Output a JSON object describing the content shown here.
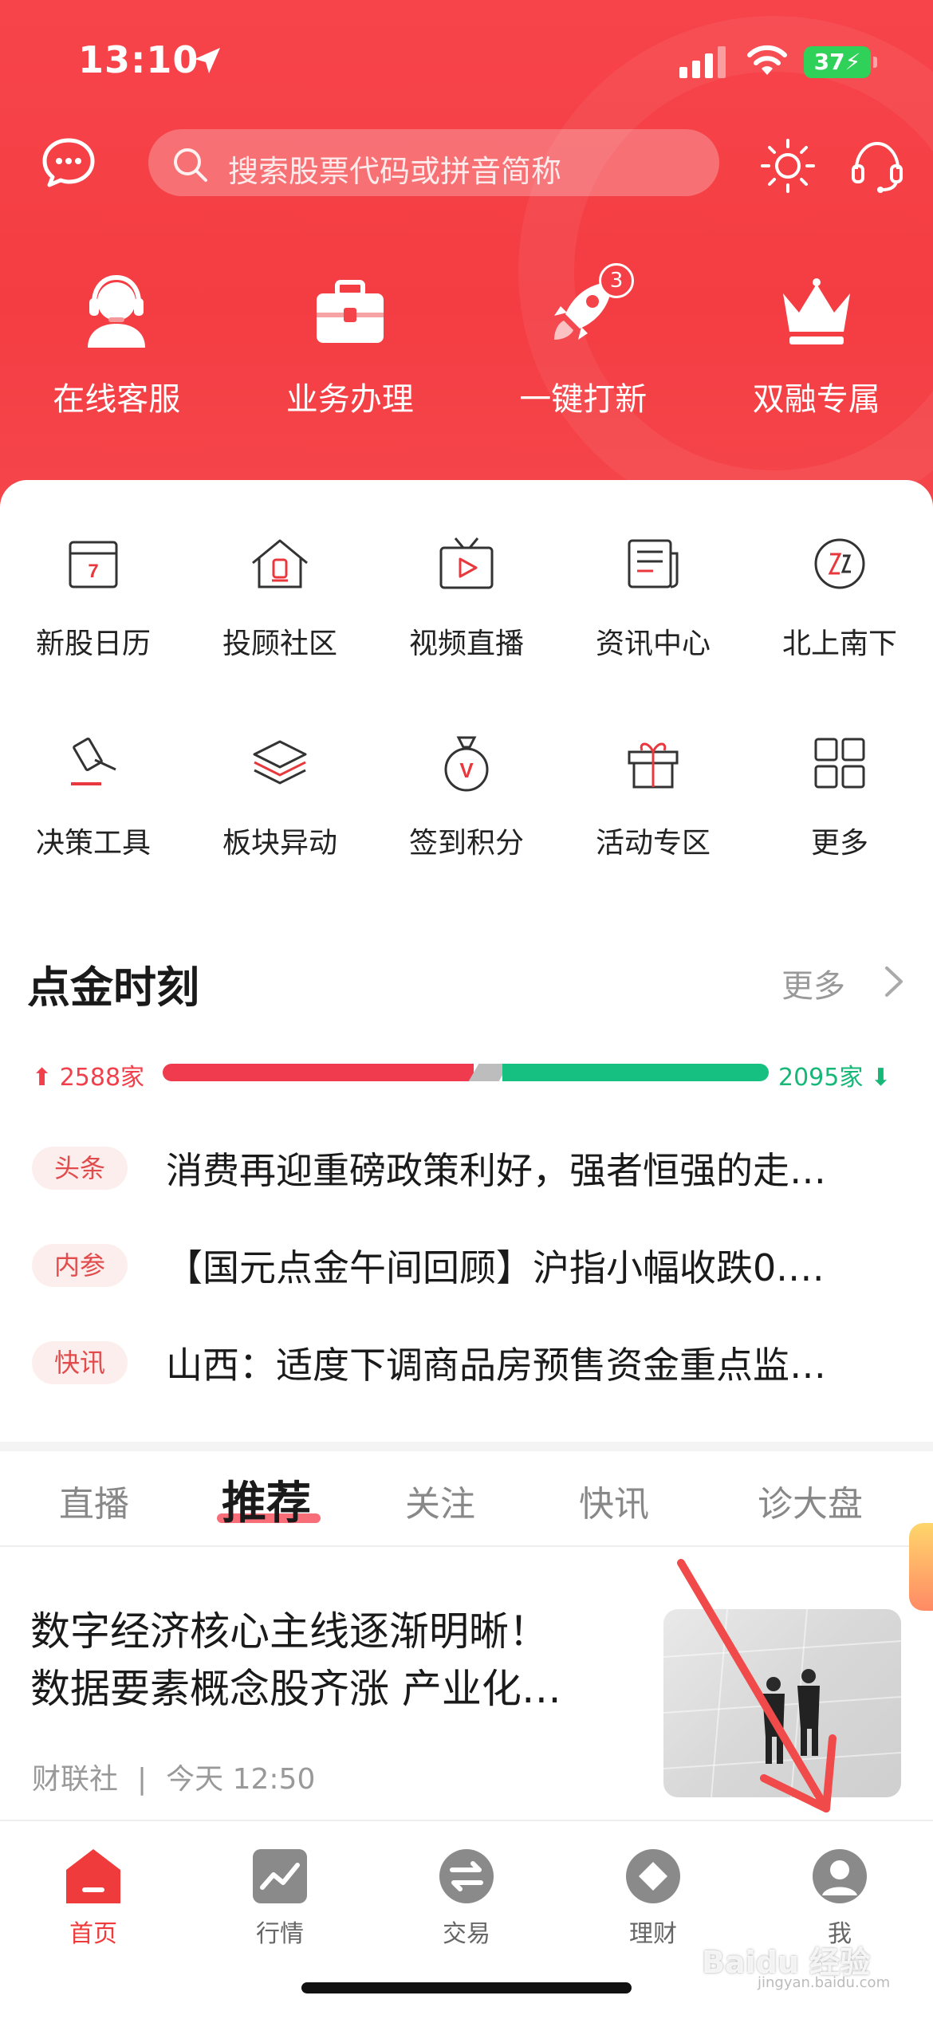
{
  "status": {
    "time": "13:10",
    "battery": "37"
  },
  "search": {
    "placeholder": "搜索股票代码或拼音简称"
  },
  "quick_actions": [
    {
      "label": "在线客服",
      "icon": "customer-service-icon"
    },
    {
      "label": "业务办理",
      "icon": "briefcase-icon"
    },
    {
      "label": "一键打新",
      "icon": "rocket-icon",
      "badge": "3"
    },
    {
      "label": "双融专属",
      "icon": "crown-icon"
    }
  ],
  "grid_row1": [
    {
      "label": "新股日历",
      "icon": "calendar-icon",
      "icon_text": "7"
    },
    {
      "label": "投顾社区",
      "icon": "community-house-icon"
    },
    {
      "label": "视频直播",
      "icon": "tv-play-icon"
    },
    {
      "label": "资讯中心",
      "icon": "news-doc-icon"
    },
    {
      "label": "北上南下",
      "icon": "north-south-icon"
    }
  ],
  "grid_row2": [
    {
      "label": "决策工具",
      "icon": "gavel-icon"
    },
    {
      "label": "板块异动",
      "icon": "layers-icon"
    },
    {
      "label": "签到积分",
      "icon": "points-bag-icon",
      "icon_text": "V"
    },
    {
      "label": "活动专区",
      "icon": "gift-icon"
    },
    {
      "label": "更多",
      "icon": "more-grid-icon"
    }
  ],
  "section": {
    "title": "点金时刻",
    "more": "更多"
  },
  "market_breadth": {
    "up": "2588家",
    "down": "2095家",
    "up_value": 2588,
    "down_value": 2095
  },
  "news": [
    {
      "tag": "头条",
      "text": "消费再迎重磅政策利好，强者恒强的走…"
    },
    {
      "tag": "内参",
      "text": "【国元点金午间回顾】沪指小幅收跌0.…"
    },
    {
      "tag": "快讯",
      "text": "山西：适度下调商品房预售资金重点监…"
    }
  ],
  "tabs": [
    "直播",
    "推荐",
    "关注",
    "快讯",
    "诊大盘"
  ],
  "tabs_active": "推荐",
  "article": {
    "title_line1": "数字经济核心主线逐渐明晰！",
    "title_line2": "数据要素概念股齐涨 产业化…",
    "source": "财联社",
    "separator": "|",
    "time": "今天 12:50"
  },
  "bottom_nav": [
    {
      "label": "首页",
      "icon": "home-icon",
      "active": true
    },
    {
      "label": "行情",
      "icon": "market-chart-icon"
    },
    {
      "label": "交易",
      "icon": "trade-exchange-icon"
    },
    {
      "label": "理财",
      "icon": "wealth-icon"
    },
    {
      "label": "我",
      "icon": "profile-icon"
    }
  ],
  "watermark": {
    "text": "Baidu 经验",
    "sub": "jingyan.baidu.com"
  },
  "colors": {
    "brand_red": "#f4444a",
    "up_red": "#ef3b4d",
    "down_green": "#16c080"
  }
}
